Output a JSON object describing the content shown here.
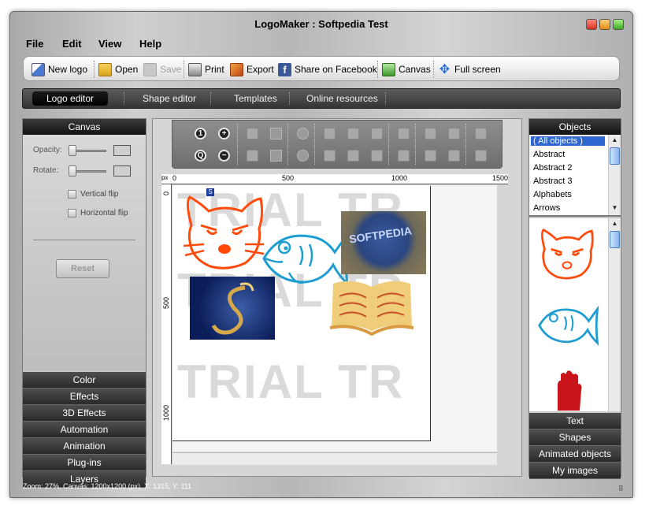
{
  "window": {
    "title": "LogoMaker : Softpedia Test"
  },
  "menu": [
    "File",
    "Edit",
    "View",
    "Help"
  ],
  "toolbar": {
    "new_logo": "New logo",
    "open": "Open",
    "save": "Save",
    "print": "Print",
    "export": "Export",
    "share_facebook": "Share on Facebook",
    "canvas": "Canvas",
    "full_screen": "Full screen"
  },
  "tabs": [
    "Logo editor",
    "Shape editor",
    "Templates",
    "Online resources"
  ],
  "left_panel": {
    "header": "Canvas",
    "opacity_label": "Opacity:",
    "rotate_label": "Rotate:",
    "vertical_flip": "Vertical flip",
    "horizontal_flip": "Horizontal flip",
    "reset": "Reset",
    "sections": [
      "Color",
      "Effects",
      "3D Effects",
      "Automation",
      "Animation",
      "Plug-ins",
      "Layers"
    ]
  },
  "ruler": {
    "unit": "px",
    "top_ticks": [
      "0",
      "500",
      "1000",
      "1500"
    ],
    "left_ticks": [
      "0",
      "500",
      "1000"
    ]
  },
  "canvas": {
    "watermark_lines": [
      "TRIAL TR",
      "TRIAL TR",
      "TRIAL TR"
    ],
    "selected_badge": "S",
    "softpedia_text": "SOFTPEDIA"
  },
  "right_panel": {
    "header": "Objects",
    "categories": [
      "( All objects )",
      "Abstract",
      "Abstract 2",
      "Abstract 3",
      "Alphabets",
      "Arrows"
    ],
    "sections": [
      "Text",
      "Shapes",
      "Animated objects",
      "My images"
    ]
  },
  "status": {
    "text": "Zoom: 27%, Canvas: 1200x1200 (px), X: 1315, Y: 111"
  },
  "colors": {
    "accent_blue": "#2f66d0",
    "cat_orange": "#ff4a0a",
    "fish_blue": "#1e9ed0",
    "book_yellow": "#f0cd78"
  }
}
